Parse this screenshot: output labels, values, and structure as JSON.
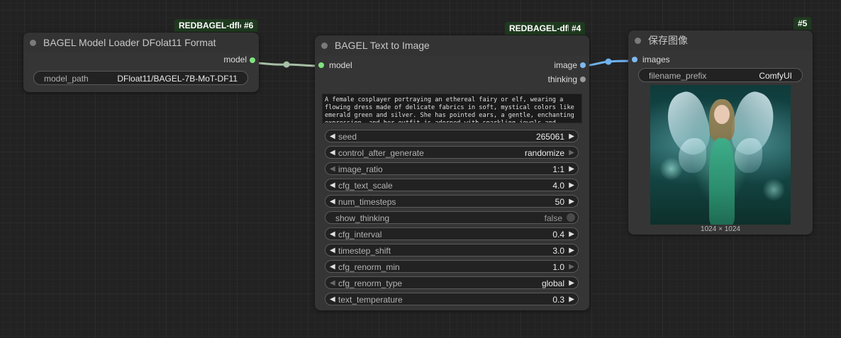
{
  "colors": {
    "badge_bg": "#1f3a1f",
    "model_wire": "#a7bfa7",
    "image_wire": "#6fb1f0"
  },
  "nodes": {
    "loader": {
      "badge_name": "REDBAGEL-dfloa",
      "badge_num": "#6",
      "title": "BAGEL Model Loader DFolat11 Format",
      "output_model": "model",
      "model_path_label": "model_path",
      "model_path_value": "DFloat11/BAGEL-7B-MoT-DF11"
    },
    "t2i": {
      "badge_name": "REDBAGEL-dflo",
      "badge_num": "#4",
      "title": "BAGEL Text to Image",
      "input_model": "model",
      "output_image": "image",
      "output_thinking": "thinking",
      "prompt": "A female cosplayer portraying an ethereal fairy or elf, wearing a flowing dress made of delicate fabrics in soft, mystical colors like emerald green and silver. She has pointed ears, a gentle, enchanting expression, and her outfit is adorned with sparkling jewels and intricate patterns. The",
      "widgets": [
        {
          "label": "seed",
          "value": "265061"
        },
        {
          "label": "control_after_generate",
          "value": "randomize"
        },
        {
          "label": "image_ratio",
          "value": "1:1"
        },
        {
          "label": "cfg_text_scale",
          "value": "4.0"
        },
        {
          "label": "num_timesteps",
          "value": "50"
        },
        {
          "label": "show_thinking",
          "value": "false"
        },
        {
          "label": "cfg_interval",
          "value": "0.4"
        },
        {
          "label": "timestep_shift",
          "value": "3.0"
        },
        {
          "label": "cfg_renorm_min",
          "value": "1.0"
        },
        {
          "label": "cfg_renorm_type",
          "value": "global"
        },
        {
          "label": "text_temperature",
          "value": "0.3"
        }
      ]
    },
    "save": {
      "badge_num": "#5",
      "title": "保存图像",
      "input_images": "images",
      "filename_prefix_label": "filename_prefix",
      "filename_prefix_value": "ComfyUI",
      "image_caption": "1024 × 1024"
    }
  }
}
